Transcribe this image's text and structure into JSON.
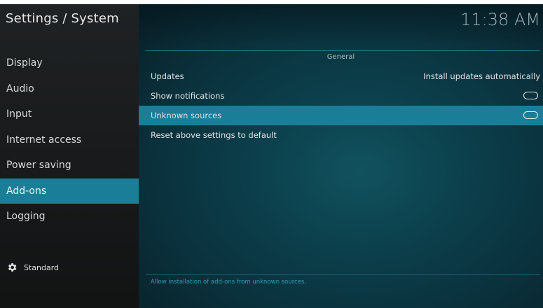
{
  "header": {
    "title": "Settings / System",
    "clock": "11:38 AM"
  },
  "sidebar": {
    "items": [
      {
        "label": "Display"
      },
      {
        "label": "Audio"
      },
      {
        "label": "Input"
      },
      {
        "label": "Internet access"
      },
      {
        "label": "Power saving"
      },
      {
        "label": "Add-ons"
      },
      {
        "label": "Logging"
      }
    ],
    "active_index": 5,
    "settings_level": {
      "label": "Standard",
      "icon": "gear-icon"
    }
  },
  "main": {
    "group_title": "General",
    "settings": [
      {
        "label": "Updates",
        "value": "Install updates automatically"
      },
      {
        "label": "Show notifications",
        "control": "toggle",
        "state": "off"
      },
      {
        "label": "Unknown sources",
        "control": "toggle",
        "state": "off",
        "focused": true
      },
      {
        "label": "Reset above settings to default"
      }
    ],
    "hint": "Allow installation of add-ons from unknown sources."
  },
  "colors": {
    "accent": "#1b7e98",
    "background_main": "#0b3f4b",
    "sidebar": "#1c1f21",
    "hint_text": "#2f9cb5"
  }
}
